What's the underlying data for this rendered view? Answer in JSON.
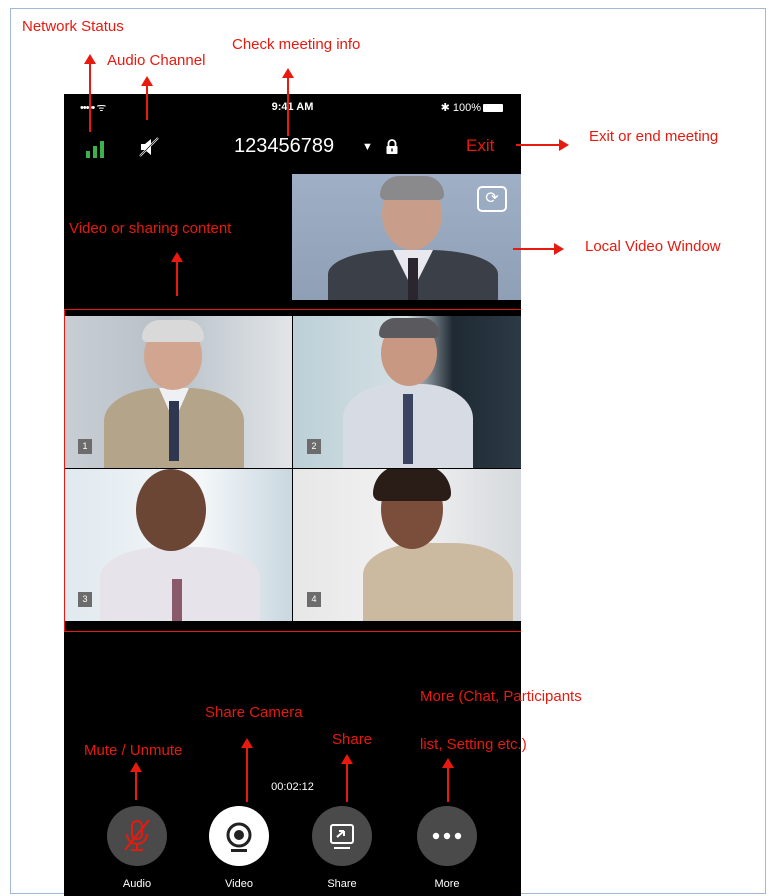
{
  "annotations": {
    "network_status": "Network Status",
    "audio_channel": "Audio Channel",
    "check_meeting_info": "Check meeting info",
    "exit_or_end": "Exit or end meeting",
    "video_or_sharing": "Video or sharing content",
    "local_video_window": "Local Video Window",
    "share_camera": "Share Camera",
    "mute_unmute": "Mute / Unmute",
    "share": "Share",
    "more_line1": "More  (Chat,  Participants",
    "more_line2": "list,  Setting etc.)"
  },
  "status_bar": {
    "signal": "••••• ",
    "wifi": "ᯤ",
    "time": "9:41 AM",
    "bluetooth": "✱",
    "battery": "100%"
  },
  "meeting": {
    "id": "123456789",
    "caret": "▼",
    "exit_label": "Exit",
    "network_bars": "network-bars-icon",
    "audio_icon": "speaker-muted-icon",
    "lock_icon": "lock-icon"
  },
  "tiles": [
    {
      "number": "1"
    },
    {
      "number": "2"
    },
    {
      "number": "3"
    },
    {
      "number": "4"
    }
  ],
  "timer": "00:02:12",
  "toolbar": {
    "audio": "Audio",
    "video": "Video",
    "share": "Share",
    "more": "More"
  },
  "colors": {
    "annotation_red": "#e8190f",
    "network_green": "#3cb24b",
    "phone_bg": "#000000"
  }
}
